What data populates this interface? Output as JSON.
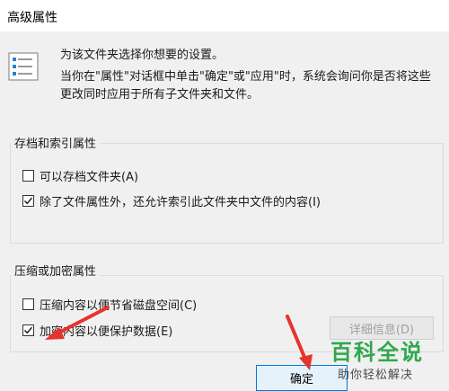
{
  "window": {
    "title": "高级属性"
  },
  "intro": {
    "line1": "为该文件夹选择你想要的设置。",
    "line2": "当你在\"属性\"对话框中单击\"确定\"或\"应用\"时，系统会询问你是否将这些更改同时应用于所有子文件夹和文件。"
  },
  "archive_group": {
    "label": "存档和索引属性",
    "options": [
      {
        "label": "可以存档文件夹(A)",
        "checked": false
      },
      {
        "label": "除了文件属性外，还允许索引此文件夹中文件的内容(I)",
        "checked": true
      }
    ]
  },
  "compress_group": {
    "label": "压缩或加密属性",
    "options": [
      {
        "label": "压缩内容以便节省磁盘空间(C)",
        "checked": false
      },
      {
        "label": "加密内容以便保护数据(E)",
        "checked": true
      }
    ],
    "details_button": "详细信息(D)"
  },
  "footer": {
    "ok_button": "确定"
  },
  "watermark": {
    "title": "百科全说",
    "subtitle": "助你轻松解决"
  },
  "colors": {
    "accent": "#0078d7",
    "arrow": "#e8322e",
    "watermark": "#2fa84f"
  }
}
